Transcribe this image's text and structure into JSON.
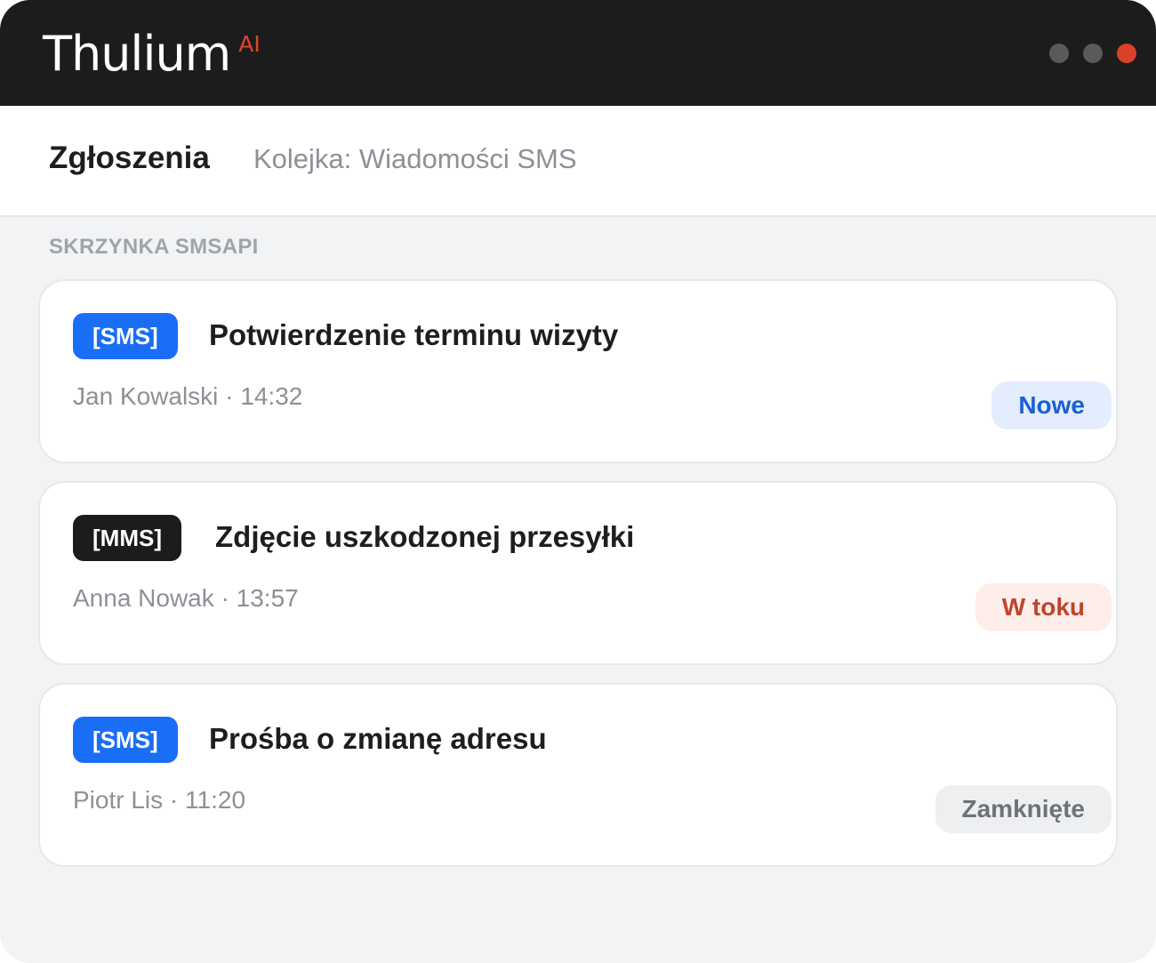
{
  "app": {
    "logo_text": "Thulium",
    "logo_sup": "AI"
  },
  "header": {
    "title": "Zgłoszenia",
    "queue": "Kolejka: Wiadomości SMS"
  },
  "section": {
    "label": "SKRZYNKA SMSAPI"
  },
  "tickets": [
    {
      "type": "[SMS]",
      "title": "Potwierdzenie terminu wizyty",
      "meta": "Jan Kowalski · 14:32",
      "status": "Nowe",
      "status_color": "#1a5fd6",
      "status_bg": "#e4edfd"
    },
    {
      "type": "[MMS]",
      "title": "Zdjęcie uszkodzonej przesyłki",
      "meta": "Anna Nowak · 13:57",
      "status": "W toku",
      "status_color": "#c0432c",
      "status_bg": "#fdeee9"
    },
    {
      "type": "[SMS]",
      "title": "Prośba o zmianę adresu",
      "meta": "Piotr Lis · 11:20",
      "status": "Zamknięte",
      "status_color": "#6e7278",
      "status_bg": "#eeeff1"
    }
  ],
  "colors": {
    "titlebar": "#1c1c1c",
    "accent": "#e0452c",
    "sms_badge": "#1a6ef5",
    "mms_badge": "#1c1c1c"
  }
}
